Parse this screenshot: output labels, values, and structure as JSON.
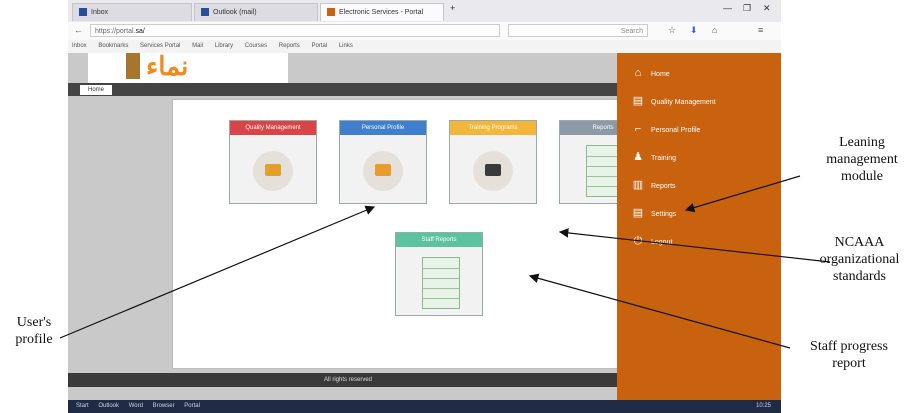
{
  "browser": {
    "tabs": [
      {
        "label": "Inbox"
      },
      {
        "label": "Outlook (mail)"
      },
      {
        "label": "Electronic Services - Portal"
      }
    ],
    "new_tab": "+",
    "window_controls": [
      "—",
      "❐",
      "✕"
    ],
    "url_prefix": "https://portal.",
    "url_host": "sa/",
    "search_placeholder": "Search",
    "bookmarks": [
      "Inbox",
      "Bookmarks",
      "Services Portal",
      "Mail",
      "Library",
      "Courses",
      "Reports",
      "Portal",
      "Links"
    ]
  },
  "page": {
    "logo_text": "نماء",
    "breadcrumb": "Home",
    "footer": "All rights reserved",
    "cards": [
      {
        "title": "Quality Management",
        "color": "#d94448"
      },
      {
        "title": "Personal Profile",
        "color": "#3f7fcb"
      },
      {
        "title": "Training Programs",
        "color": "#f2b63a"
      },
      {
        "title": "Reports",
        "color": "#8c99a6"
      },
      {
        "title": "Staff Reports",
        "color": "#5cc2a0"
      }
    ],
    "menu": [
      {
        "label": "Home",
        "icon": "home-icon",
        "glyph": "⌂"
      },
      {
        "label": "Quality Management",
        "icon": "grid-icon",
        "glyph": "▤"
      },
      {
        "label": "Personal Profile",
        "icon": "staircase-icon",
        "glyph": "⌐"
      },
      {
        "label": "Training",
        "icon": "user-icon",
        "glyph": "♟"
      },
      {
        "label": "Reports",
        "icon": "bar-chart-icon",
        "glyph": "▥"
      },
      {
        "label": "Settings",
        "icon": "card-icon",
        "glyph": "▤"
      },
      {
        "label": "Logout",
        "icon": "power-icon",
        "glyph": "⏻"
      }
    ]
  },
  "taskbar": {
    "items": [
      "Start",
      "Outlook",
      "Word",
      "Browser",
      "Portal"
    ],
    "clock": "10:25"
  },
  "annotations": {
    "users_profile": "User's\nprofile",
    "learning_module": "Leaning\nmanagement\nmodule",
    "ncaaa": "NCAAA\norganizational\nstandards",
    "staff_progress": "Staff progress\nreport"
  }
}
